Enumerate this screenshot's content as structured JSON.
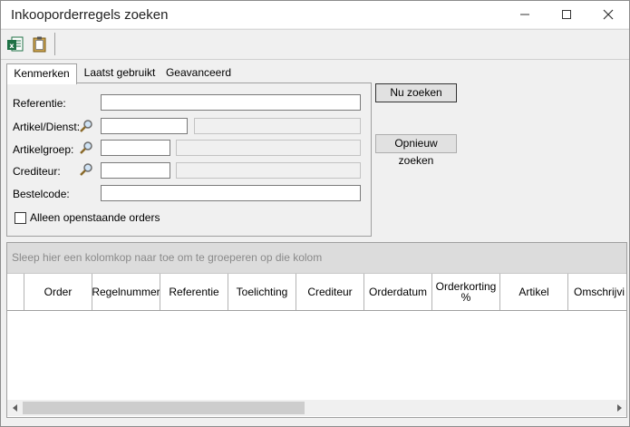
{
  "window": {
    "title": "Inkooporderregels zoeken",
    "controls": {
      "minimize": "minimize-icon",
      "maximize": "maximize-icon",
      "close": "close-icon"
    }
  },
  "toolbar": {
    "buttons": [
      {
        "icon": "excel-export-icon"
      },
      {
        "icon": "clipboard-icon"
      }
    ]
  },
  "tabs": [
    {
      "label": "Kenmerken",
      "active": true
    },
    {
      "label": "Laatst gebruikt",
      "active": false
    },
    {
      "label": "Geavanceerd",
      "active": false
    }
  ],
  "form": {
    "referentie": {
      "label": "Referentie:",
      "value": ""
    },
    "artikel": {
      "label": "Artikel/Dienst:",
      "value": "",
      "description": ""
    },
    "artikelgroep": {
      "label": "Artikelgroep:",
      "value": "",
      "description": ""
    },
    "crediteur": {
      "label": "Crediteur:",
      "value": "",
      "description": ""
    },
    "bestelcode": {
      "label": "Bestelcode:",
      "value": ""
    },
    "open_only": {
      "label": "Alleen openstaande orders",
      "checked": false
    }
  },
  "buttons": {
    "search_now": "Nu zoeken",
    "search_again": "Opnieuw zoeken"
  },
  "grid": {
    "group_hint": "Sleep hier een kolomkop naar toe om te groeperen op die kolom",
    "columns": [
      {
        "label": ""
      },
      {
        "label": "Order"
      },
      {
        "label": "Regelnummer"
      },
      {
        "label": "Referentie"
      },
      {
        "label": "Toelichting"
      },
      {
        "label": "Crediteur"
      },
      {
        "label": "Orderdatum"
      },
      {
        "label": "Orderkorting %"
      },
      {
        "label": "Artikel"
      },
      {
        "label": "Omschrijvi"
      }
    ],
    "rows": []
  },
  "colors": {
    "window_bg": "#f0f0f0",
    "group_panel_bg": "#dcdcdc",
    "excel_green": "#1e7145"
  }
}
